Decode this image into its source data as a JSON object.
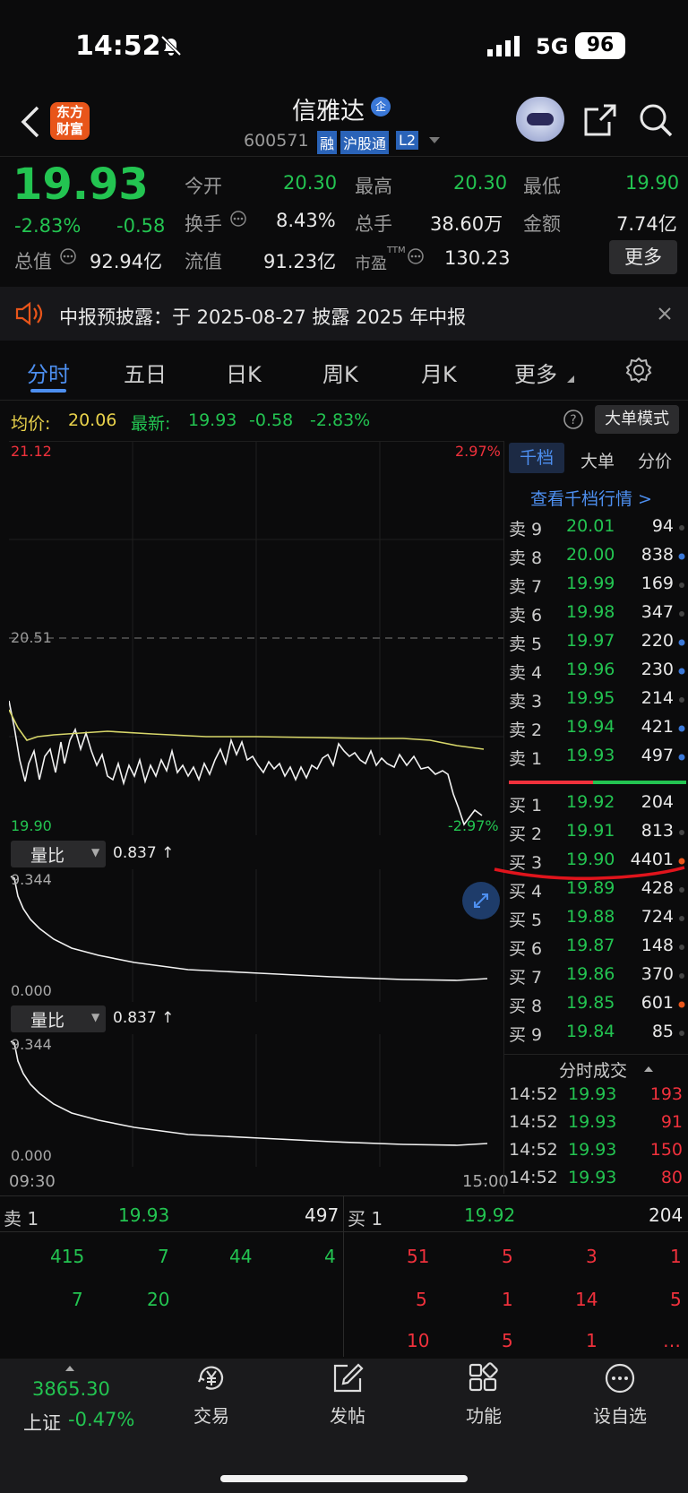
{
  "status": {
    "time": "14:52",
    "network": "5G",
    "battery": "96"
  },
  "header": {
    "title": "信雅达",
    "code": "600571",
    "badges": [
      "融",
      "沪股通",
      "L2"
    ],
    "brand": "东方\n财富"
  },
  "quote": {
    "price": "19.93",
    "pct": "-2.83%",
    "chg": "-0.58",
    "labels": {
      "open": "今开",
      "high": "最高",
      "low": "最低",
      "turnover": "换手",
      "volume": "总手",
      "amount": "金额",
      "mcap": "总值",
      "float": "流值",
      "pe": "市盈",
      "pe_sup": "TTM"
    },
    "open": "20.30",
    "high": "20.30",
    "low": "19.90",
    "turnover": "8.43%",
    "volume": "38.60万",
    "amount": "7.74亿",
    "mcap": "92.94亿",
    "float": "91.23亿",
    "pe": "130.23",
    "more": "更多"
  },
  "notice": {
    "text": "中报预披露：于 2025-08-27 披露 2025 年中报"
  },
  "tabs": [
    "分时",
    "五日",
    "日K",
    "周K",
    "月K",
    "更多"
  ],
  "infoline": {
    "avg_label": "均价:",
    "avg": "20.06",
    "last_label": "最新:",
    "last": "19.93",
    "chg": "-0.58",
    "pct": "-2.83%",
    "mode": "大单模式"
  },
  "chart": {
    "ymax": "21.12",
    "ymid": "20.51",
    "ymin": "19.90",
    "pmax": "2.97%",
    "pmin": "-2.97%",
    "t_start": "09:30",
    "t_end": "15:00"
  },
  "sub1": {
    "label": "量比",
    "value": "0.837 ↑",
    "top": "9.344",
    "bottom": "0.000"
  },
  "sub2": {
    "label": "量比",
    "value": "0.837 ↑",
    "top": "9.344",
    "bottom": "0.000"
  },
  "side_tabs": [
    "千档",
    "大单",
    "分价"
  ],
  "view_all": "查看千档行情 >",
  "asks": [
    [
      "卖 9",
      "20.01",
      "94"
    ],
    [
      "卖 8",
      "20.00",
      "838"
    ],
    [
      "卖 7",
      "19.99",
      "169"
    ],
    [
      "卖 6",
      "19.98",
      "347"
    ],
    [
      "卖 5",
      "19.97",
      "220"
    ],
    [
      "卖 4",
      "19.96",
      "230"
    ],
    [
      "卖 3",
      "19.95",
      "214"
    ],
    [
      "卖 2",
      "19.94",
      "421"
    ],
    [
      "卖 1",
      "19.93",
      "497"
    ]
  ],
  "bids": [
    [
      "买 1",
      "19.92",
      "204"
    ],
    [
      "买 2",
      "19.91",
      "813"
    ],
    [
      "买 3",
      "19.90",
      "4401"
    ],
    [
      "买 4",
      "19.89",
      "428"
    ],
    [
      "买 5",
      "19.88",
      "724"
    ],
    [
      "买 6",
      "19.87",
      "148"
    ],
    [
      "买 7",
      "19.86",
      "370"
    ],
    [
      "买 8",
      "19.85",
      "601"
    ],
    [
      "买 9",
      "19.84",
      "85"
    ]
  ],
  "trades_title": "分时成交",
  "trades": [
    [
      "14:52",
      "19.93",
      "193"
    ],
    [
      "14:52",
      "19.93",
      "91"
    ],
    [
      "14:52",
      "19.93",
      "150"
    ],
    [
      "14:52",
      "19.93",
      "80"
    ]
  ],
  "queue": {
    "ask_label": "卖 1",
    "ask_price": "19.93",
    "ask_vol": "497",
    "bid_label": "买 1",
    "bid_price": "19.92",
    "bid_vol": "204",
    "ask_rows": [
      [
        "415",
        "7",
        "44",
        "4"
      ],
      [
        "7",
        "20",
        "",
        ""
      ]
    ],
    "bid_rows": [
      [
        "51",
        "5",
        "3",
        "1"
      ],
      [
        "5",
        "1",
        "14",
        "5"
      ],
      [
        "10",
        "5",
        "1",
        "…"
      ]
    ]
  },
  "index": {
    "value": "3865.30",
    "name": "上证",
    "pct": "-0.47%"
  },
  "nav": [
    "交易",
    "发帖",
    "功能",
    "设自选"
  ]
}
